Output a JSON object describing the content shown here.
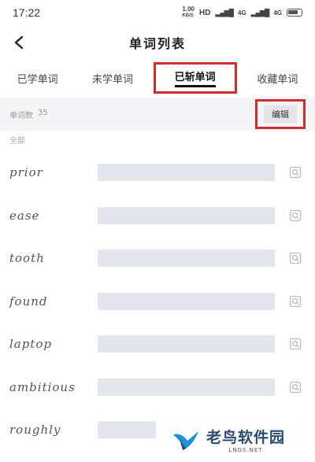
{
  "status_bar": {
    "time": "17:22",
    "speed": "1.00",
    "speed_unit": "KB/S",
    "hd": "HD",
    "signal_5g": "4G",
    "signal_4g": "4G"
  },
  "header": {
    "title": "单词列表"
  },
  "tabs": [
    {
      "label": "已学单词",
      "active": false
    },
    {
      "label": "未学单词",
      "active": false
    },
    {
      "label": "已斩单词",
      "active": true
    },
    {
      "label": "收藏单词",
      "active": false
    }
  ],
  "summary": {
    "count_label": "单词数",
    "count_value": "35",
    "edit_label": "编辑",
    "section_label": "全部"
  },
  "words": [
    {
      "word": "prior"
    },
    {
      "word": "ease"
    },
    {
      "word": "tooth"
    },
    {
      "word": "found"
    },
    {
      "word": "laptop"
    },
    {
      "word": "ambitious"
    },
    {
      "word": "roughly"
    }
  ],
  "watermark": {
    "main": "老鸟软件园",
    "sub": "LNGS.NET"
  },
  "colors": {
    "highlight": "#d42b2b",
    "meaning_box": "#e5e6ec",
    "summary_bg": "#f5f5f7"
  }
}
